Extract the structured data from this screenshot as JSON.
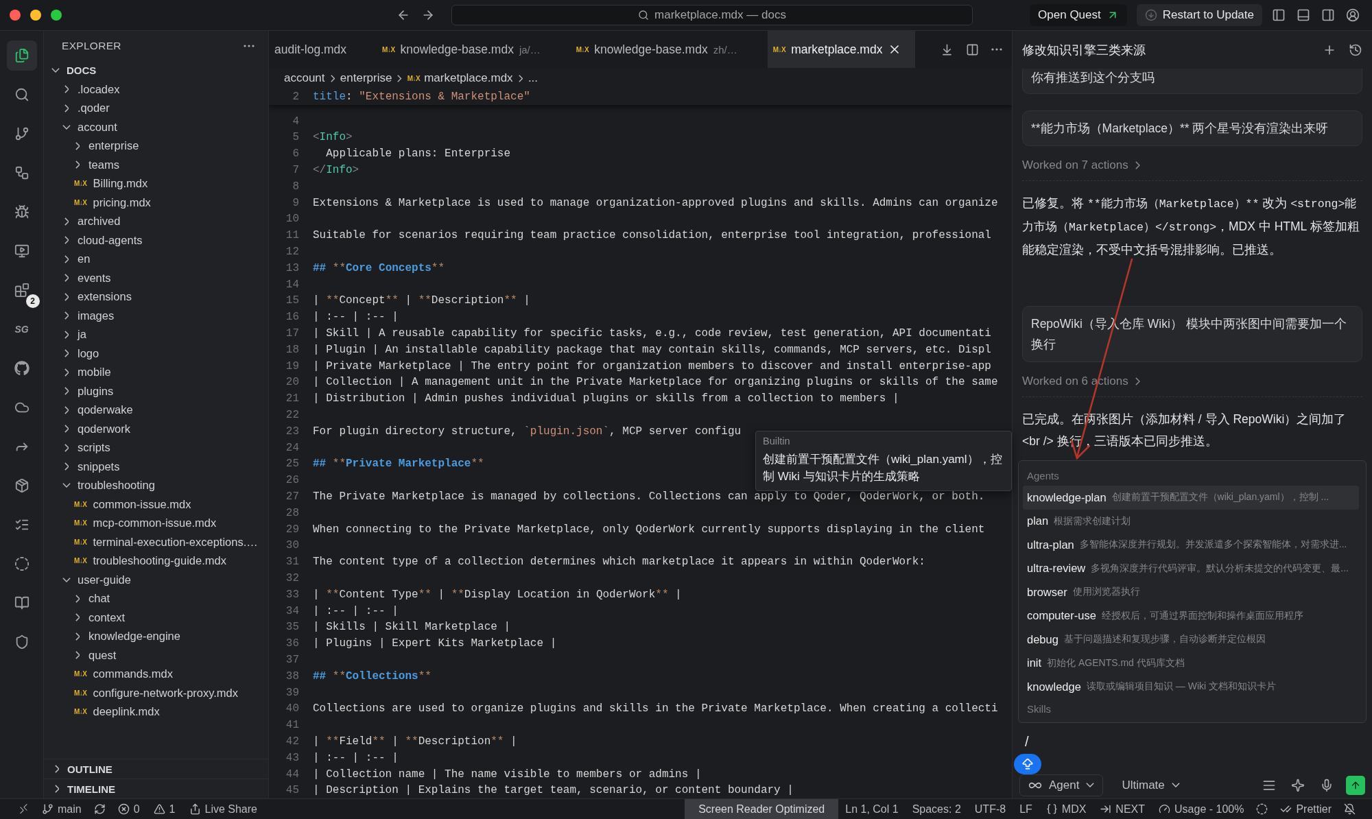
{
  "title_bar": {
    "search": "marketplace.mdx — docs",
    "buttons": [
      {
        "kind": "quest",
        "label": "Open Quest"
      },
      {
        "kind": "update",
        "label": "Restart to Update"
      }
    ]
  },
  "activity_bar": [
    {
      "kind": "files",
      "selected": true
    },
    {
      "kind": "search",
      "selected": false
    },
    {
      "kind": "source-control",
      "selected": false
    },
    {
      "kind": "graph",
      "selected": false
    },
    {
      "kind": "run-debug",
      "selected": false
    },
    {
      "kind": "remote",
      "selected": false
    },
    {
      "kind": "extensions",
      "selected": false,
      "badge": "2"
    },
    {
      "kind": "label",
      "label": "SG",
      "selected": false
    },
    {
      "kind": "github",
      "selected": false
    },
    {
      "kind": "cloud",
      "selected": false
    },
    {
      "kind": "share",
      "selected": false
    },
    {
      "kind": "package",
      "selected": false
    },
    {
      "kind": "checklist",
      "selected": false
    },
    {
      "kind": "circle",
      "selected": false
    },
    {
      "kind": "book",
      "selected": false
    },
    {
      "kind": "shield",
      "selected": false
    }
  ],
  "explorer": {
    "title": "EXPLORER",
    "root": {
      "name": "DOCS",
      "expanded": true,
      "items": [
        {
          "kind": "folder",
          "name": ".locadex",
          "expanded": false
        },
        {
          "kind": "folder",
          "name": ".qoder",
          "expanded": false
        },
        {
          "kind": "folder",
          "name": "account",
          "expanded": true,
          "children": [
            {
              "kind": "folder",
              "name": "enterprise",
              "expanded": false
            },
            {
              "kind": "folder",
              "name": "teams",
              "expanded": false
            },
            {
              "kind": "file",
              "name": "Billing.mdx",
              "icon_text": "M↓X"
            },
            {
              "kind": "file",
              "name": "pricing.mdx",
              "icon_text": "M↓X"
            }
          ]
        },
        {
          "kind": "folder",
          "name": "archived",
          "expanded": false
        },
        {
          "kind": "folder",
          "name": "cloud-agents",
          "expanded": false
        },
        {
          "kind": "folder",
          "name": "en",
          "expanded": false
        },
        {
          "kind": "folder",
          "name": "events",
          "expanded": false
        },
        {
          "kind": "folder",
          "name": "extensions",
          "expanded": false
        },
        {
          "kind": "folder",
          "name": "images",
          "expanded": false
        },
        {
          "kind": "folder",
          "name": "ja",
          "expanded": false
        },
        {
          "kind": "folder",
          "name": "logo",
          "expanded": false
        },
        {
          "kind": "folder",
          "name": "mobile",
          "expanded": false
        },
        {
          "kind": "folder",
          "name": "plugins",
          "expanded": false
        },
        {
          "kind": "folder",
          "name": "qoderwake",
          "expanded": false
        },
        {
          "kind": "folder",
          "name": "qoderwork",
          "expanded": false
        },
        {
          "kind": "folder",
          "name": "scripts",
          "expanded": false
        },
        {
          "kind": "folder",
          "name": "snippets",
          "expanded": false
        },
        {
          "kind": "folder",
          "name": "troubleshooting",
          "expanded": true,
          "children": [
            {
              "kind": "file",
              "name": "common-issue.mdx",
              "icon_text": "M↓X"
            },
            {
              "kind": "file",
              "name": "mcp-common-issue.mdx",
              "icon_text": "M↓X"
            },
            {
              "kind": "file",
              "name": "terminal-execution-exceptions.…",
              "icon_text": "M↓X"
            },
            {
              "kind": "file",
              "name": "troubleshooting-guide.mdx",
              "icon_text": "M↓X"
            }
          ]
        },
        {
          "kind": "folder",
          "name": "user-guide",
          "expanded": true,
          "children": [
            {
              "kind": "folder",
              "name": "chat",
              "expanded": false
            },
            {
              "kind": "folder",
              "name": "context",
              "expanded": false
            },
            {
              "kind": "folder",
              "name": "knowledge-engine",
              "expanded": false
            },
            {
              "kind": "folder",
              "name": "quest",
              "expanded": false
            },
            {
              "kind": "file",
              "name": "commands.mdx",
              "icon_text": "M↓X"
            },
            {
              "kind": "file",
              "name": "configure-network-proxy.mdx",
              "icon_text": "M↓X"
            },
            {
              "kind": "file",
              "name": "deeplink.mdx",
              "icon_text": "M↓X"
            }
          ]
        }
      ]
    },
    "sections": [
      {
        "title": "OUTLINE",
        "expanded": false
      },
      {
        "title": "TIMELINE",
        "expanded": false
      }
    ]
  },
  "tabs": [
    {
      "label": "audit-log.mdx",
      "selected": false
    },
    {
      "label": "knowledge-base.mdx",
      "icon_text": "M↓X",
      "hint": "ja/…",
      "selected": false
    },
    {
      "label": "knowledge-base.mdx",
      "icon_text": "M↓X",
      "hint": "zh/…",
      "selected": false
    },
    {
      "label": "marketplace.mdx",
      "icon_text": "M↓X",
      "selected": true
    }
  ],
  "breadcrumb": [
    {
      "text": "account"
    },
    {
      "text": "enterprise"
    },
    {
      "text": "marketplace.mdx",
      "icon_text": "M↓X"
    },
    {
      "text": "..."
    }
  ],
  "editor": {
    "sticky": {
      "n": "2",
      "t": [
        {
          "kind": "key",
          "text": "title"
        },
        {
          "kind": "plain",
          "text": ": "
        },
        {
          "kind": "string",
          "text": "\"Extensions & Marketplace\""
        }
      ]
    },
    "lines": [
      {
        "n": "4"
      },
      {
        "n": "5",
        "t": [
          {
            "kind": "punct",
            "text": "<"
          },
          {
            "kind": "tag",
            "text": "Info"
          },
          {
            "kind": "punct",
            "text": ">"
          }
        ]
      },
      {
        "n": "6",
        "t": [
          {
            "kind": "plain",
            "text": "  Applicable plans: Enterprise"
          }
        ]
      },
      {
        "n": "7",
        "t": [
          {
            "kind": "punct",
            "text": "</"
          },
          {
            "kind": "tag",
            "text": "Info"
          },
          {
            "kind": "punct",
            "text": ">"
          }
        ]
      },
      {
        "n": "8"
      },
      {
        "n": "9",
        "t": [
          {
            "kind": "plain",
            "text": "Extensions & Marketplace is used to manage organization-approved plugins and skills. Admins can organize"
          }
        ]
      },
      {
        "n": "10"
      },
      {
        "n": "11",
        "t": [
          {
            "kind": "plain",
            "text": "Suitable for scenarios requiring team practice consolidation, enterprise tool integration, professional"
          }
        ]
      },
      {
        "n": "12"
      },
      {
        "n": "13",
        "t": [
          {
            "kind": "heading",
            "text": "## "
          },
          {
            "kind": "mark",
            "text": "**"
          },
          {
            "kind": "heading",
            "text": "Core Concepts"
          },
          {
            "kind": "mark",
            "text": "**"
          }
        ]
      },
      {
        "n": "14"
      },
      {
        "n": "15",
        "t": [
          {
            "kind": "plain",
            "text": "| "
          },
          {
            "kind": "mark",
            "text": "**"
          },
          {
            "kind": "plain",
            "text": "Concept"
          },
          {
            "kind": "mark",
            "text": "**"
          },
          {
            "kind": "plain",
            "text": " | "
          },
          {
            "kind": "mark",
            "text": "**"
          },
          {
            "kind": "plain",
            "text": "Description"
          },
          {
            "kind": "mark",
            "text": "**"
          },
          {
            "kind": "plain",
            "text": " |"
          }
        ]
      },
      {
        "n": "16",
        "t": [
          {
            "kind": "plain",
            "text": "| :-- | :-- |"
          }
        ]
      },
      {
        "n": "17",
        "t": [
          {
            "kind": "plain",
            "text": "| Skill | A reusable capability for specific tasks, e.g., code review, test generation, API documentati"
          }
        ]
      },
      {
        "n": "18",
        "t": [
          {
            "kind": "plain",
            "text": "| Plugin | An installable capability package that may contain skills, commands, MCP servers, etc. Displ"
          }
        ]
      },
      {
        "n": "19",
        "t": [
          {
            "kind": "plain",
            "text": "| Private Marketplace | The entry point for organization members to discover and install enterprise-app"
          }
        ]
      },
      {
        "n": "20",
        "t": [
          {
            "kind": "plain",
            "text": "| Collection | A management unit in the Private Marketplace for organizing plugins or skills of the same"
          }
        ]
      },
      {
        "n": "21",
        "t": [
          {
            "kind": "plain",
            "text": "| Distribution | Admin pushes individual plugins or skills from a collection to members |"
          }
        ]
      },
      {
        "n": "22"
      },
      {
        "n": "23",
        "t": [
          {
            "kind": "plain",
            "text": "For plugin directory structure, "
          },
          {
            "kind": "code",
            "text": "`plugin.json`"
          },
          {
            "kind": "plain",
            "text": ", MCP server configu"
          }
        ]
      },
      {
        "n": "24"
      },
      {
        "n": "25",
        "t": [
          {
            "kind": "heading",
            "text": "## "
          },
          {
            "kind": "mark",
            "text": "**"
          },
          {
            "kind": "heading",
            "text": "Private Marketplace"
          },
          {
            "kind": "mark",
            "text": "**"
          }
        ]
      },
      {
        "n": "26"
      },
      {
        "n": "27",
        "t": [
          {
            "kind": "plain",
            "text": "The Private Marketplace is managed by collections. Collections can apply to Qoder, QoderWork, or both."
          }
        ]
      },
      {
        "n": "28"
      },
      {
        "n": "29",
        "t": [
          {
            "kind": "plain",
            "text": "When connecting to the Private Marketplace, only QoderWork currently supports displaying in the client"
          }
        ]
      },
      {
        "n": "30"
      },
      {
        "n": "31",
        "t": [
          {
            "kind": "plain",
            "text": "The content type of a collection determines which marketplace it appears in within QoderWork:"
          }
        ]
      },
      {
        "n": "32"
      },
      {
        "n": "33",
        "t": [
          {
            "kind": "plain",
            "text": "| "
          },
          {
            "kind": "mark",
            "text": "**"
          },
          {
            "kind": "plain",
            "text": "Content Type"
          },
          {
            "kind": "mark",
            "text": "**"
          },
          {
            "kind": "plain",
            "text": " | "
          },
          {
            "kind": "mark",
            "text": "**"
          },
          {
            "kind": "plain",
            "text": "Display Location in QoderWork"
          },
          {
            "kind": "mark",
            "text": "**"
          },
          {
            "kind": "plain",
            "text": " |"
          }
        ]
      },
      {
        "n": "34",
        "t": [
          {
            "kind": "plain",
            "text": "| :-- | :-- |"
          }
        ]
      },
      {
        "n": "35",
        "t": [
          {
            "kind": "plain",
            "text": "| Skills | Skill Marketplace |"
          }
        ]
      },
      {
        "n": "36",
        "t": [
          {
            "kind": "plain",
            "text": "| Plugins | Expert Kits Marketplace |"
          }
        ]
      },
      {
        "n": "37"
      },
      {
        "n": "38",
        "t": [
          {
            "kind": "heading",
            "text": "## "
          },
          {
            "kind": "mark",
            "text": "**"
          },
          {
            "kind": "heading",
            "text": "Collections"
          },
          {
            "kind": "mark",
            "text": "**"
          }
        ]
      },
      {
        "n": "39"
      },
      {
        "n": "40",
        "t": [
          {
            "kind": "plain",
            "text": "Collections are used to organize plugins and skills in the Private Marketplace. When creating a collecti"
          }
        ]
      },
      {
        "n": "41"
      },
      {
        "n": "42",
        "t": [
          {
            "kind": "plain",
            "text": "| "
          },
          {
            "kind": "mark",
            "text": "**"
          },
          {
            "kind": "plain",
            "text": "Field"
          },
          {
            "kind": "mark",
            "text": "**"
          },
          {
            "kind": "plain",
            "text": " | "
          },
          {
            "kind": "mark",
            "text": "**"
          },
          {
            "kind": "plain",
            "text": "Description"
          },
          {
            "kind": "mark",
            "text": "**"
          },
          {
            "kind": "plain",
            "text": " |"
          }
        ]
      },
      {
        "n": "43",
        "t": [
          {
            "kind": "plain",
            "text": "| :-- | :-- |"
          }
        ]
      },
      {
        "n": "44",
        "t": [
          {
            "kind": "plain",
            "text": "| Collection name | The name visible to members or admins |"
          }
        ]
      },
      {
        "n": "45",
        "t": [
          {
            "kind": "plain",
            "text": "| Description | Explains the target team, scenario, or content boundary |"
          }
        ]
      }
    ],
    "tooltip": {
      "title": "Builtin",
      "text": "创建前置干预配置文件（wiki_plan.yaml），控制 Wiki 与知识卡片的生成策略"
    }
  },
  "chat": {
    "title": "修改知识引擎三类来源",
    "messages": [
      {
        "kind": "user",
        "text": "你有推送到这个分支吗"
      },
      {
        "kind": "user",
        "text": "**能力市场（Marketplace）**  两个星号没有渲染出来呀"
      },
      {
        "kind": "actions",
        "text": "Worked on 7 actions"
      },
      {
        "kind": "assistant",
        "parts": [
          {
            "text": "已修复。将 ",
            "code": false
          },
          {
            "text": "**能力市场（Marketplace）**",
            "code": true
          },
          {
            "text": " 改为 ",
            "code": false
          },
          {
            "text": "<strong>能力市场（Marketplace）</strong>",
            "code": true
          },
          {
            "text": "，MDX 中 HTML 标签加粗能稳定渲染，不受中文括号混排影响。已推送。",
            "code": false
          }
        ]
      },
      {
        "kind": "user",
        "text": "RepoWiki（导入仓库 Wiki）  模块中两张图中间需要加一个换行"
      },
      {
        "kind": "actions",
        "text": "Worked on 6 actions"
      },
      {
        "kind": "assistant",
        "parts": [
          {
            "text": "已完成。在两张图片（添加材料 / 导入 RepoWiki）之间加了 <br /> 换行，三语版本已同步推送。",
            "code": false
          }
        ]
      }
    ],
    "menu": {
      "sections": [
        {
          "title": "Agents",
          "items": [
            {
              "name": "knowledge-plan",
              "description": "创建前置干预配置文件（wiki_plan.yaml），控制 ...",
              "selected": true
            },
            {
              "name": "plan",
              "description": "根据需求创建计划",
              "selected": false
            },
            {
              "name": "ultra-plan",
              "description": "多智能体深度并行规划。并发派遣多个探索智能体，对需求进...",
              "selected": false
            },
            {
              "name": "ultra-review",
              "description": "多视角深度并行代码评审。默认分析未提交的代码变更、最...",
              "selected": false
            },
            {
              "name": "browser",
              "description": "使用浏览器执行",
              "selected": false
            },
            {
              "name": "computer-use",
              "description": "经授权后，可通过界面控制和操作桌面应用程序",
              "selected": false
            },
            {
              "name": "debug",
              "description": "基于问题描述和复现步骤，自动诊断并定位根因",
              "selected": false
            },
            {
              "name": "init",
              "description": "初始化 AGENTS.md 代码库文档",
              "selected": false
            },
            {
              "name": "knowledge",
              "description": "读取或编辑项目知识 — Wiki 文档和知识卡片",
              "selected": false
            }
          ]
        },
        {
          "title": "Skills"
        }
      ]
    },
    "composer": {
      "value": "/",
      "mode": "Agent",
      "model": "Ultimate"
    }
  },
  "status_bar": {
    "left": [
      {
        "kind": "remote"
      },
      {
        "kind": "branch",
        "text": "main"
      },
      {
        "kind": "sync"
      },
      {
        "kind": "errors",
        "text": "0"
      },
      {
        "kind": "warnings",
        "text": "1"
      },
      {
        "kind": "live-share",
        "text": "Live Share"
      }
    ],
    "right": [
      {
        "kind": "highlight",
        "text": "Screen Reader Optimized"
      },
      {
        "kind": "plain",
        "text": "Ln 1, Col 1"
      },
      {
        "kind": "plain",
        "text": "Spaces: 2"
      },
      {
        "kind": "plain",
        "text": "UTF-8"
      },
      {
        "kind": "plain",
        "text": "LF"
      },
      {
        "kind": "language",
        "text": "MDX"
      },
      {
        "kind": "next",
        "text": "NEXT"
      },
      {
        "kind": "usage",
        "text": "Usage - 100%"
      },
      {
        "kind": "copilot"
      },
      {
        "kind": "prettier",
        "text": "Prettier"
      },
      {
        "kind": "bell"
      }
    ]
  }
}
